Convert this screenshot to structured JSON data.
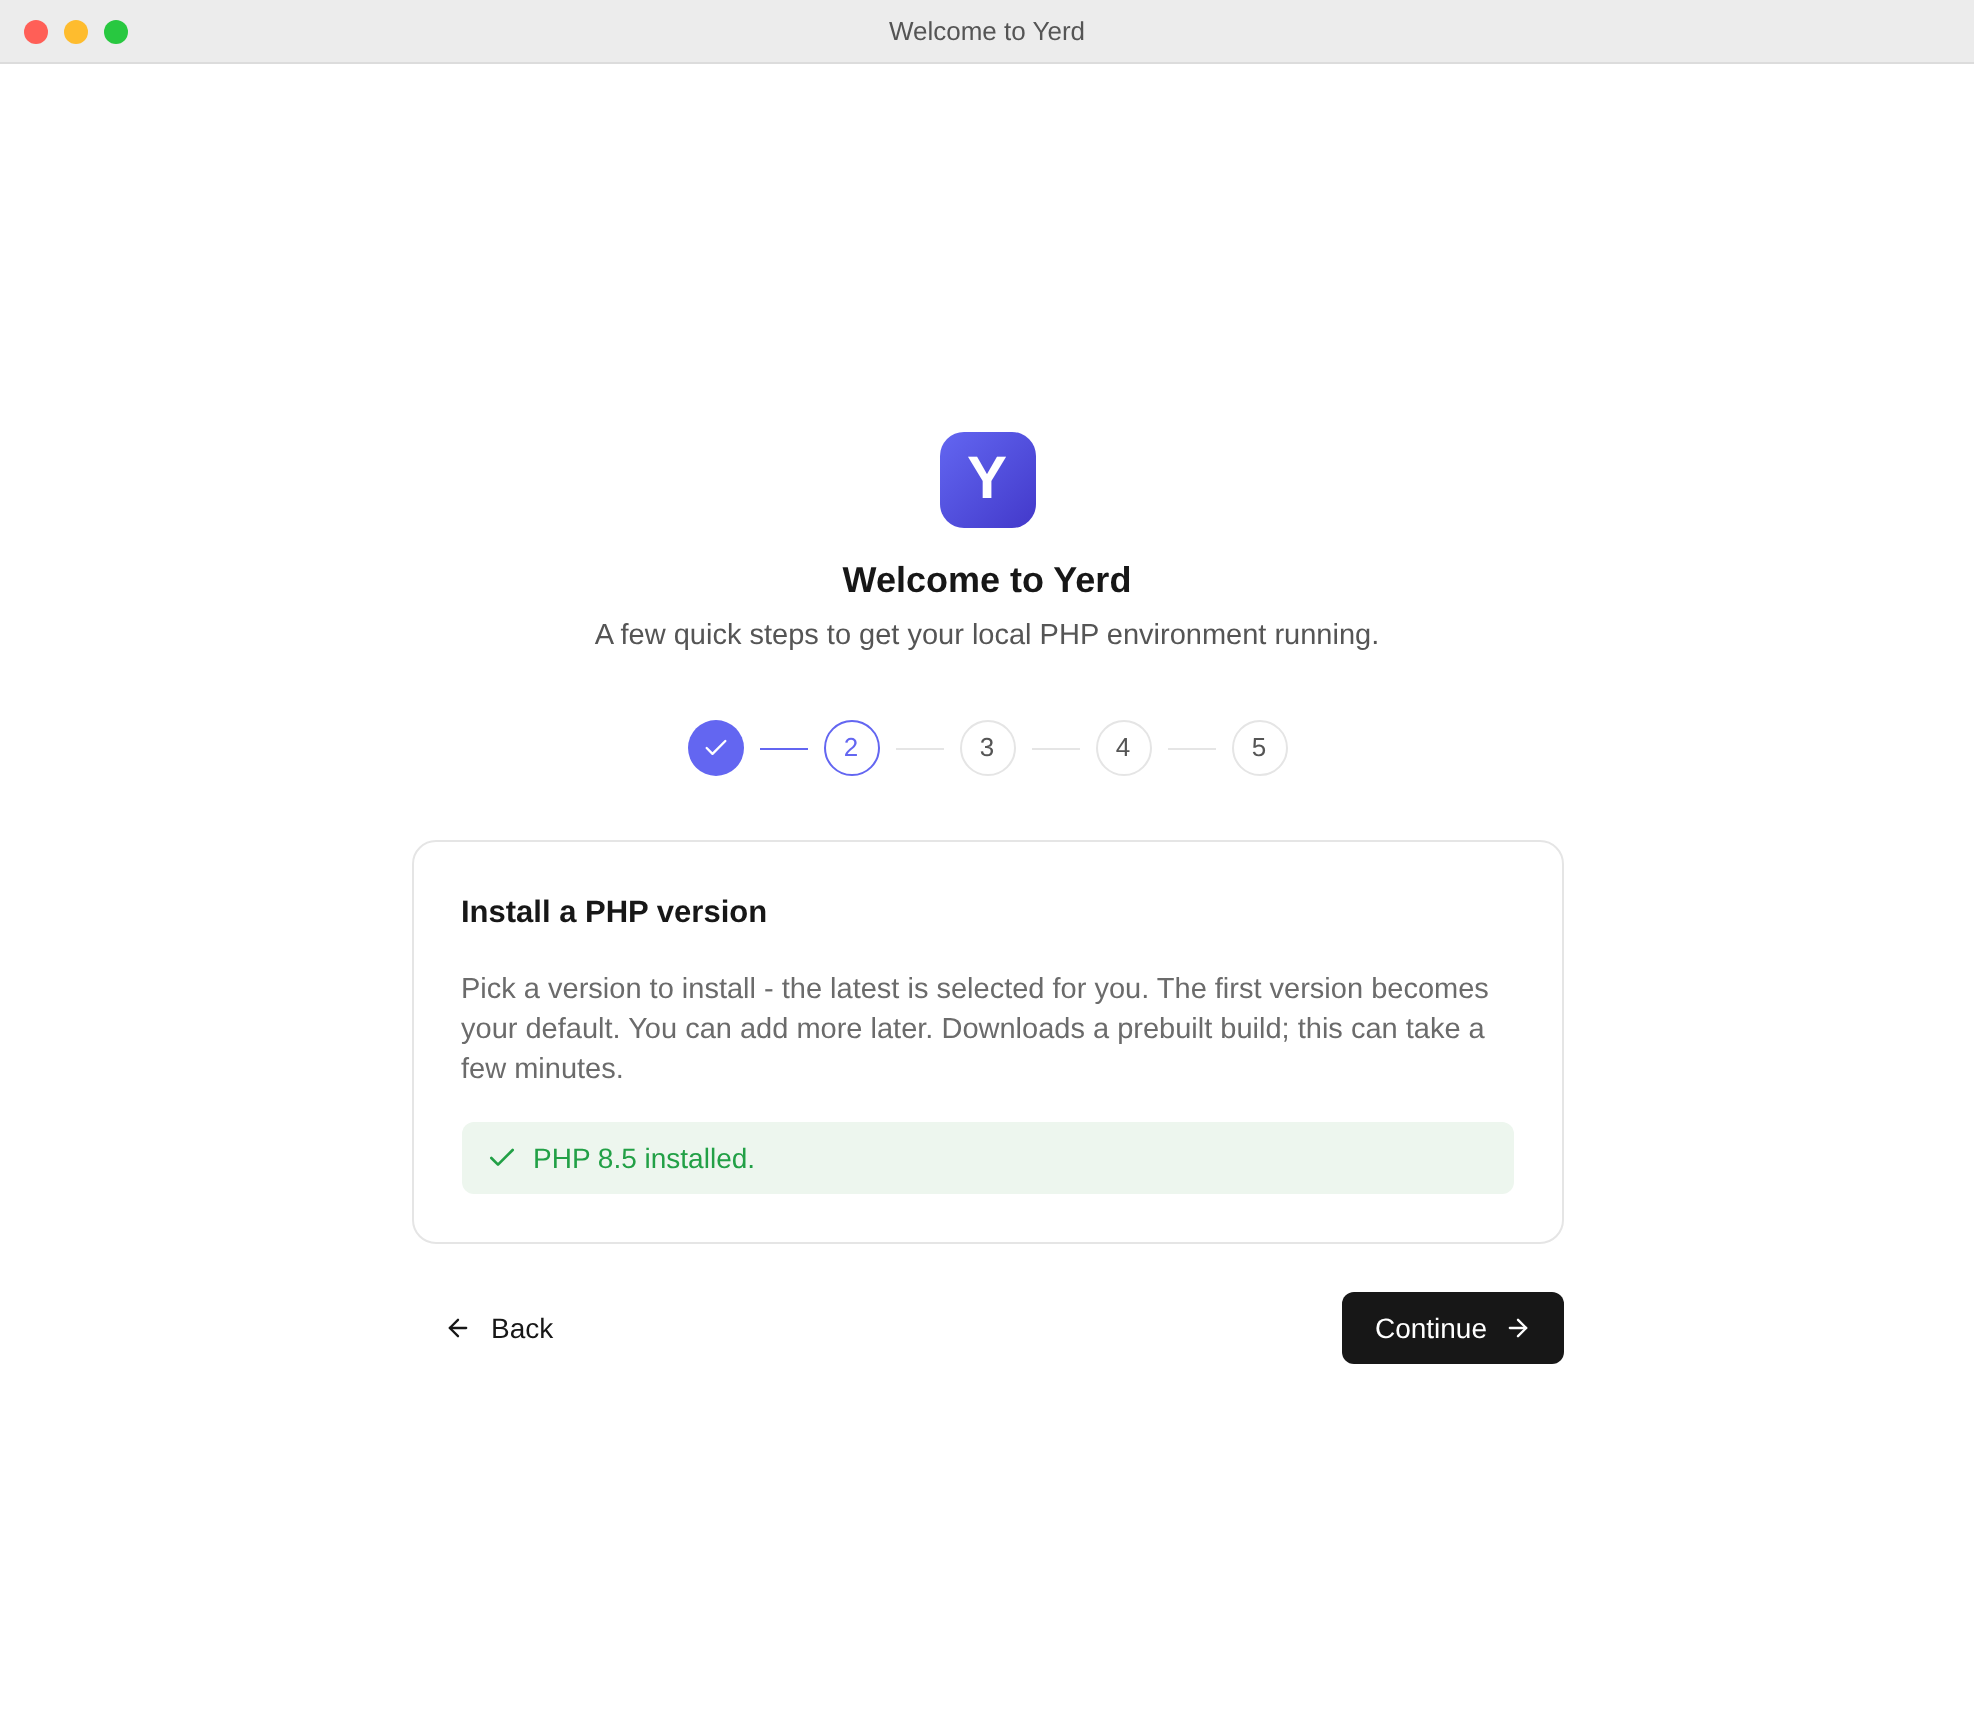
{
  "window": {
    "title": "Welcome to Yerd"
  },
  "header": {
    "logo": "Y",
    "title": "Welcome to Yerd",
    "subtitle": "A few quick steps to get your local PHP environment running."
  },
  "steps": [
    {
      "completed": true,
      "selected": false
    },
    {
      "label": "2",
      "completed": false,
      "selected": true
    },
    {
      "label": "3",
      "completed": false,
      "selected": false
    },
    {
      "label": "4",
      "completed": false,
      "selected": false
    },
    {
      "label": "5",
      "completed": false,
      "selected": false
    }
  ],
  "card": {
    "title": "Install a PHP version",
    "description": "Pick a version to install - the latest is selected for you. The first version becomes your default. You can add more later. Downloads a prebuilt build; this can take a few minutes.",
    "status": {
      "kind": "success",
      "message": "PHP 8.5 installed."
    }
  },
  "actions": {
    "back": "Back",
    "continue": "Continue"
  }
}
